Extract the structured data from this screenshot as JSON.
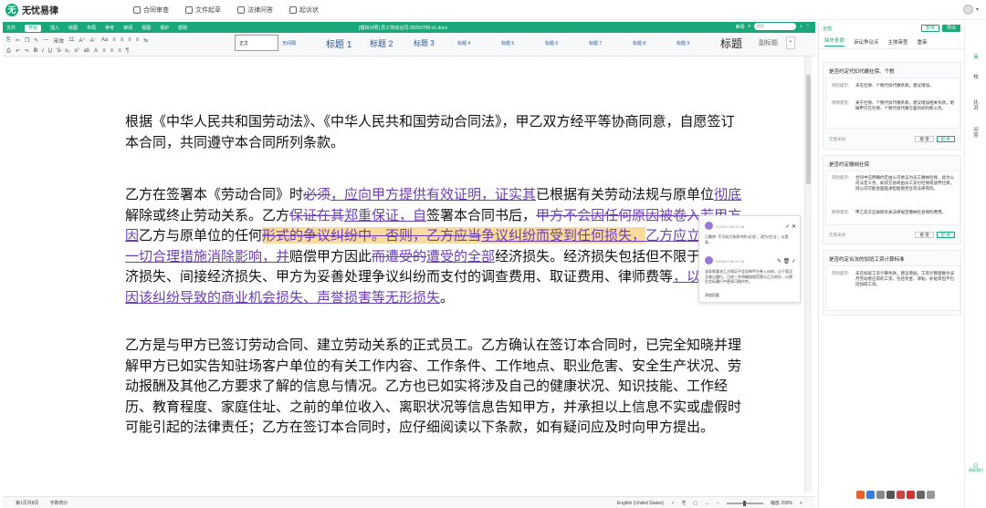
{
  "app": {
    "logo_text": "无忧易律",
    "nav": [
      "合同审查",
      "文件起草",
      "法律问答",
      "起诉状"
    ]
  },
  "editor": {
    "menu": [
      "文件",
      "开始",
      "插入",
      "绘图",
      "布局",
      "参考",
      "审阅",
      "视图",
      "保护",
      "帮助"
    ],
    "active_menu": "开始",
    "doc_title": "[理和对照] 员工劳动合同-20250708-v1.docx",
    "tools_row1": [
      "⎘",
      "✂",
      "❐",
      "✎",
      "—",
      "宋体",
      "11",
      "A⁺",
      "A⁻",
      "Aa",
      "≡",
      "≡",
      "≡",
      "≡",
      "⇆"
    ],
    "tools_row2": [
      "⎙",
      "↶",
      "↷",
      "𝐁",
      "𝐼",
      "U̲",
      "S̶",
      "x₂",
      "x²",
      "ab",
      "A",
      "≡",
      "≡",
      "≡",
      "¶"
    ],
    "styles": [
      {
        "label": "正文",
        "cls": "normal"
      },
      {
        "label": "无间隔",
        "cls": "plain"
      },
      {
        "label": "标题 1",
        "cls": "h1"
      },
      {
        "label": "标题 2",
        "cls": "h2"
      },
      {
        "label": "标题 3",
        "cls": "h3"
      },
      {
        "label": "标题 4",
        "cls": "plain"
      },
      {
        "label": "标题 5",
        "cls": "plain"
      },
      {
        "label": "标题 6",
        "cls": "plain"
      },
      {
        "label": "标题 7",
        "cls": "plain"
      },
      {
        "label": "标题 8",
        "cls": "plain"
      },
      {
        "label": "标题 9",
        "cls": "plain"
      },
      {
        "label": "标题",
        "cls": "big"
      },
      {
        "label": "副标题",
        "cls": "sub"
      }
    ],
    "search_placeholder": "搜索",
    "comment_label": "审阅",
    "status_left": [
      "第1页共8页",
      "字数统计"
    ],
    "status_lang": "English (United States)",
    "zoom": "缩放 258%",
    "zoom_fraction": 0.5
  },
  "document": {
    "p1": "根据《中华人民共和国劳动法》、《中华人民共和国劳动合同法》，甲乙双方经平等协商同意，自愿签订本合同，共同遵守本合同所列条款。",
    "p2": [
      {
        "t": "乙方在签署本《劳动合同》时",
        "k": "n"
      },
      {
        "t": "必须",
        "k": "d"
      },
      {
        "t": "，应向甲方提供有效证明，证实其",
        "k": "i"
      },
      {
        "t": "已根据有关劳动法规与原单位",
        "k": "n"
      },
      {
        "t": "彻底",
        "k": "i"
      },
      {
        "t": "解除或终止劳动关系。乙方",
        "k": "n"
      },
      {
        "t": "保证在其",
        "k": "d"
      },
      {
        "t": "郑重保证，自",
        "k": "i"
      },
      {
        "t": "签署本合同书后，",
        "k": "n"
      },
      {
        "t": "甲方不会因任何原因被卷入",
        "k": "d"
      },
      {
        "t": "若甲方因",
        "k": "i"
      },
      {
        "t": "乙方与原单位的任何",
        "k": "n"
      },
      {
        "t": "形式的争议纠纷中。否则，乙方应当",
        "k": "dh"
      },
      {
        "t": "争议纠纷而受到任何损失，",
        "k": "ih"
      },
      {
        "t": "乙方应立即采取一切合理措施消除影响，并",
        "k": "i"
      },
      {
        "t": "赔偿甲方因此",
        "k": "n"
      },
      {
        "t": "而遭受的",
        "k": "d"
      },
      {
        "t": "遭受的全部",
        "k": "i"
      },
      {
        "t": "经济损失。经济损失包括但不限于直接经济损失、间接经济损失、甲方为妥善处理争议纠纷而支付的调查费用、取证费用、律师费等",
        "k": "n"
      },
      {
        "t": "，以及甲方因该纠纷导致的商业机会损失、声誉损害等无形损失",
        "k": "i"
      },
      {
        "t": "。",
        "k": "n"
      }
    ],
    "p3": "乙方是与甲方已签订劳动合同、建立劳动关系的正式员工。乙方确认在签订本合同时，已完全知晓并理解甲方已如实告知驻场客户单位的有关工作内容、工作条件、工作地点、职业危害、安全生产状况、劳动报酬及其他乙方要求了解的信息与情况。乙方也已如实将涉及自己的健康状况、知识技能、工作经历、教育程度、家庭住址、之前的单位收入、离职状况等信息告知甲方，并承担以上信息不实或虚假时可能引起的法律责任；乙方在签订本合同时，应仔细阅读以下条款，如有疑问应及时向甲方提出。"
  },
  "comments": [
    {
      "meta": "2025/07/08 20:28",
      "body": "已删除: 不可抗力条款中的“必须”，改为“应当”，以提高...",
      "actions": "✓ ✕"
    },
    {
      "meta": "2025/07/08 20:28",
      "body": "该条款要求乙方保证不会导致甲方卷入纠纷，过于宽泛且难以履行。可进一步明确赔偿范围与乙方责任，以便在实际履行中更具可操作性。",
      "actions": "✎ 🗑 ✓"
    }
  ],
  "comment_link": "添加回复",
  "rpanel": {
    "all_label": "全部",
    "btn_outline": "暂存",
    "btn_fill": "导出",
    "tabs": [
      "缺失条款",
      "诉讼争议点",
      "主体审查",
      "重审"
    ],
    "cards": [
      {
        "title": "是否约定代扣代缴社保、个税",
        "rows": [
          {
            "lab": "风险提示:",
            "txt": "未见社保、个税代扣代缴条款，建议增加。"
          },
          {
            "lab": "修改意见:",
            "txt": "关于社保、个税代扣代缴条款，建议增加相关条款，明确甲方在社保、个税代扣代缴方面的权利和义务。"
          }
        ],
        "foot": "无需采纳",
        "b1": "接 受",
        "b2": "拒 绝"
      },
      {
        "title": "是否约定缴纳社保",
        "rows": [
          {
            "lab": "风险提示:",
            "txt": "合同中应明确约定由公司依法为员工缴纳社保，此为公司法定义务。如双方协商由员工支付社保或放弃社保，则公司可能会面临承担赔偿责任等法律风险。"
          },
          {
            "lab": "修改意见:",
            "txt": "甲乙双方应按照有关法律规定缴纳社会保险费用。"
          }
        ],
        "foot": "无需采纳",
        "b1": "接 受",
        "b2": "拒 绝"
      },
      {
        "title": "是否约定合法的加班工资计算标准",
        "rows": [
          {
            "lab": "风险提示:",
            "txt": "未见加班工资计算条款，建议增加。工资计算基数为该月劳动者应得的工资，包括奖金、津贴、补贴等但不包括加班工资。"
          }
        ],
        "foot": "",
        "b1": "",
        "b2": ""
      }
    ],
    "strip": [
      "审",
      "校",
      "比对",
      "问答"
    ],
    "help_label": "帮助我们"
  }
}
